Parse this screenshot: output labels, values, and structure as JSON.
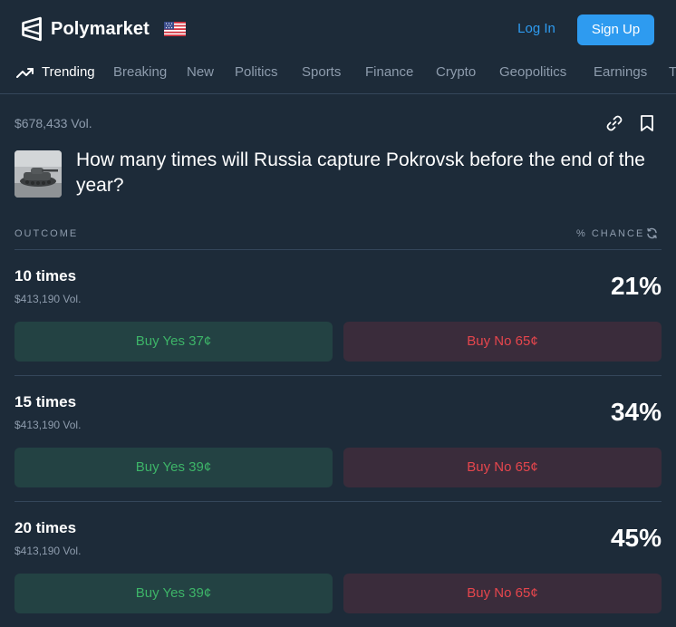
{
  "header": {
    "brand": "Polymarket",
    "login_label": "Log In",
    "signup_label": "Sign Up",
    "flag_icon": "us-flag-icon",
    "accent_color": "#2e9bf0"
  },
  "nav": {
    "items": [
      {
        "label": "Trending",
        "active": true
      },
      {
        "label": "Breaking"
      },
      {
        "label": "New"
      },
      {
        "label": "Politics"
      },
      {
        "label": "Sports"
      },
      {
        "label": "Finance"
      },
      {
        "label": "Crypto"
      },
      {
        "label": "Geopolitics"
      },
      {
        "label": "Earnings"
      },
      {
        "label": "T"
      }
    ]
  },
  "market": {
    "volume": "$678,433 Vol.",
    "title": "How many times will Russia capture Pokrovsk before the end of the year?",
    "outcome_header": "OUTCOME",
    "chance_header": "% CHANCE"
  },
  "outcomes": [
    {
      "name": "10 times",
      "volume": "$413,190 Vol.",
      "chance": "21%",
      "buy_yes": "Buy Yes 37¢",
      "buy_no": "Buy No 65¢"
    },
    {
      "name": "15 times",
      "volume": "$413,190 Vol.",
      "chance": "34%",
      "buy_yes": "Buy Yes 39¢",
      "buy_no": "Buy No 65¢"
    },
    {
      "name": "20 times",
      "volume": "$413,190 Vol.",
      "chance": "45%",
      "buy_yes": "Buy Yes 39¢",
      "buy_no": "Buy No 65¢"
    }
  ],
  "colors": {
    "background": "#1d2b39",
    "yes_text": "#3db468",
    "no_text": "#e6464d"
  }
}
